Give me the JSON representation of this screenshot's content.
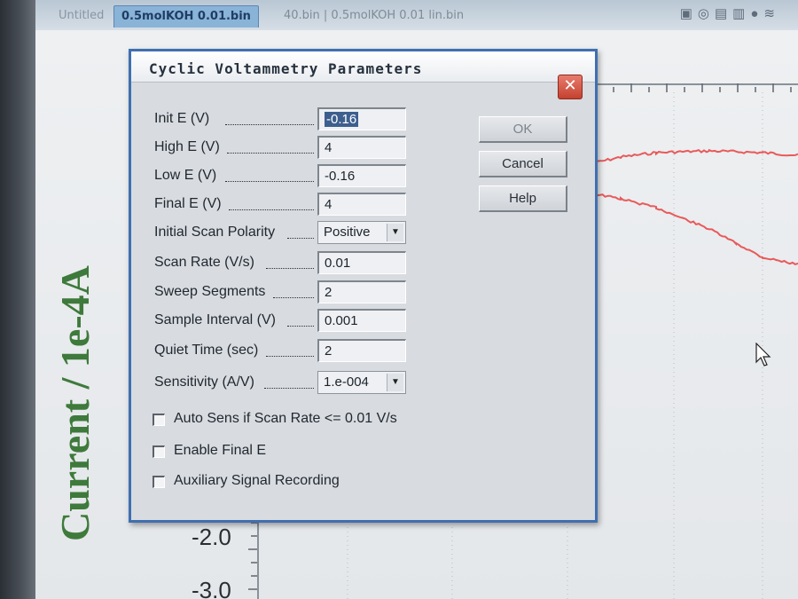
{
  "tabs": {
    "untitled": "Untitled",
    "active": "0.5molKOH  0.01.bin",
    "other": "40.bin | 0.5molKOH 0.01 lin.bin"
  },
  "plot": {
    "y_title": "Current / 1e-4A",
    "y_ticks": [
      "-2.0",
      "-3.0"
    ],
    "trace_color": "#e85a5a"
  },
  "dialog": {
    "title": "Cyclic Voltammetry Parameters",
    "close_glyph": "✕",
    "fields": [
      {
        "label": "Init E (V)",
        "value": "-0.16"
      },
      {
        "label": "High E (V)",
        "value": "4"
      },
      {
        "label": "Low E (V)",
        "value": "-0.16"
      },
      {
        "label": "Final E (V)",
        "value": "4"
      },
      {
        "label": "Initial Scan Polarity",
        "value": "Positive"
      },
      {
        "label": "Scan Rate (V/s)",
        "value": "0.01"
      },
      {
        "label": "Sweep Segments",
        "value": "2"
      },
      {
        "label": "Sample Interval (V)",
        "value": "0.001"
      },
      {
        "label": "Quiet Time (sec)",
        "value": "2"
      },
      {
        "label": "Sensitivity (A/V)",
        "value": "1.e-004"
      }
    ],
    "buttons": {
      "ok": "OK",
      "cancel": "Cancel",
      "help": "Help"
    },
    "checkboxes": [
      {
        "label": "Auto Sens if Scan Rate <= 0.01 V/s",
        "checked": false
      },
      {
        "label": "Enable Final E",
        "checked": false
      },
      {
        "label": "Auxiliary Signal Recording",
        "checked": false
      }
    ]
  },
  "colors": {
    "accent": "#3f6fb0",
    "close": "#c4412f",
    "axis_title": "#3e7a3b"
  }
}
